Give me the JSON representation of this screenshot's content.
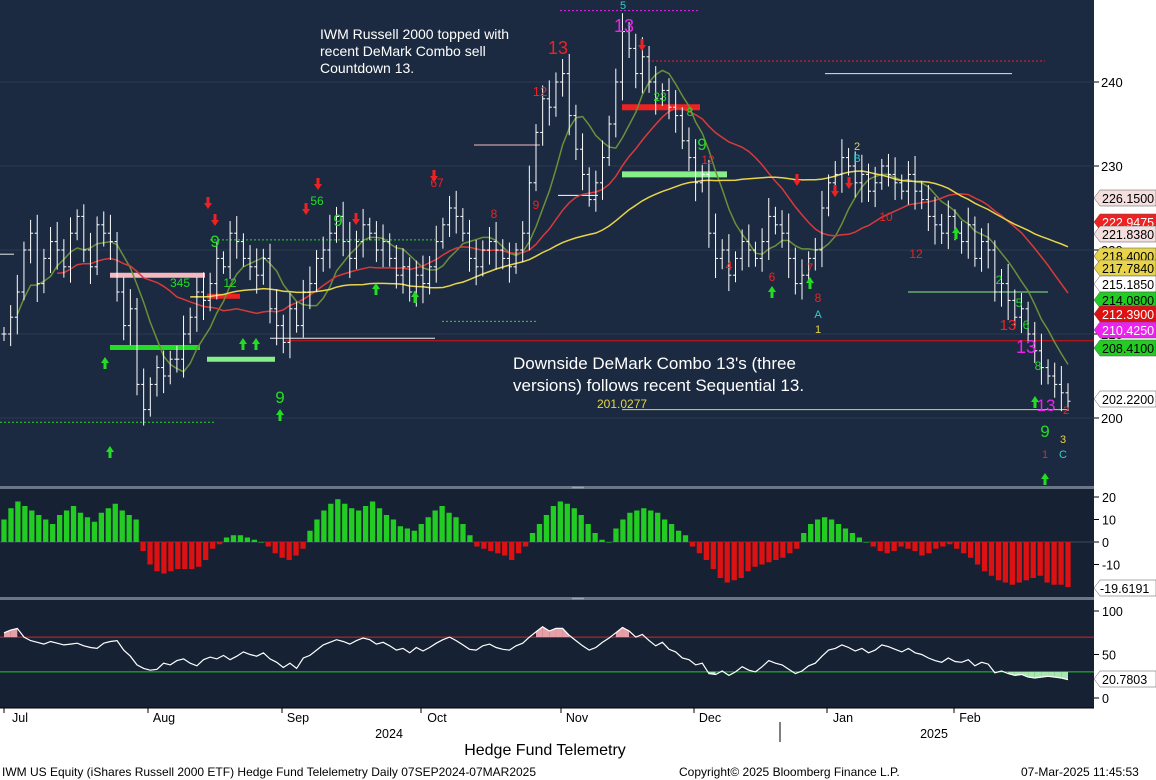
{
  "chart_title": "Hedge Fund Telemetry",
  "footer": {
    "left": "IWM US Equity (iShares Russell 2000 ETF) Hedge Fund Telelemetry  Daily 07SEP2024-07MAR2025",
    "center": "Copyright© 2025 Bloomberg Finance L.P.",
    "right": "07-Mar-2025 11:45:53"
  },
  "annotations": {
    "top_note": [
      "IWM Russell 2000 topped with",
      "recent DeMark Combo sell",
      "Countdown 13."
    ],
    "bottom_note": [
      "Downside DeMark Combo 13's (three",
      "versions) follows recent Sequential 13."
    ],
    "level_label": "201.0277"
  },
  "colors": {
    "background": "#162234",
    "price_bars": "#ffffff",
    "ma_short": "#6b8f3a",
    "ma_mid": "#d83a3a",
    "ma_long": "#e8d44a",
    "hist_pos": "#22cc22",
    "hist_neg": "#dd1111",
    "rsi_line": "#ffffff",
    "td_green": "#22dd22",
    "td_red": "#ee2222",
    "td_magenta": "#ee22ee"
  },
  "chart_data": [
    {
      "type": "candlestick",
      "panel": "price",
      "x_axis": {
        "months": [
          "Jul",
          "Aug",
          "Sep",
          "Oct",
          "Nov",
          "Dec",
          "Jan",
          "Feb"
        ],
        "years": [
          "2024",
          "2025"
        ]
      },
      "ylim": [
        190,
        250
      ],
      "yticks": [
        200,
        210,
        220,
        230,
        240
      ],
      "price_tags": [
        {
          "value": "226.1500",
          "color": "#f4dede",
          "text_color": "#000000"
        },
        {
          "value": "222.9475",
          "color": "#ee2222",
          "text_color": "#ffffff"
        },
        {
          "value": "221.8380",
          "color": "#f4dede",
          "text_color": "#000000"
        },
        {
          "value": "218.4000",
          "color": "#e8d44a",
          "text_color": "#000000"
        },
        {
          "value": "217.7840",
          "color": "#e8d44a",
          "text_color": "#000000"
        },
        {
          "value": "215.1850",
          "color": "#ffffff",
          "text_color": "#000000"
        },
        {
          "value": "214.0800",
          "color": "#22cc22",
          "text_color": "#000000"
        },
        {
          "value": "212.3900",
          "color": "#dd1111",
          "text_color": "#ffffff"
        },
        {
          "value": "210.4250",
          "color": "#ee22ee",
          "text_color": "#ffffff"
        },
        {
          "value": "208.4100",
          "color": "#22cc22",
          "text_color": "#000000"
        },
        {
          "value": "202.2200",
          "color": "#ffffff",
          "text_color": "#000000"
        }
      ],
      "close_series": [
        210,
        212,
        215,
        220,
        222,
        216,
        219,
        221,
        220,
        218,
        222,
        224,
        220,
        218,
        223,
        222,
        221,
        215,
        211,
        213,
        204,
        201,
        204,
        206,
        205,
        207,
        207,
        210,
        212,
        215,
        214,
        216,
        219,
        218,
        222,
        221,
        219,
        218,
        217,
        219,
        213,
        211,
        209,
        213,
        211,
        215,
        216,
        219,
        220,
        222,
        224,
        221,
        219,
        221,
        223,
        222,
        220,
        221,
        219,
        217,
        218,
        215,
        217,
        216,
        218,
        221,
        223,
        225,
        224,
        222,
        219,
        218,
        220,
        221,
        220,
        219,
        218,
        220,
        222,
        228,
        234,
        238,
        237,
        240,
        241,
        236,
        232,
        229,
        226,
        228,
        231,
        235,
        240,
        246,
        244,
        241,
        243,
        240,
        238,
        239,
        237,
        236,
        233,
        231,
        228,
        229,
        222,
        219,
        220,
        217,
        219,
        221,
        220,
        219,
        221,
        224,
        223,
        222,
        219,
        216,
        217,
        219,
        220,
        225,
        228,
        229,
        231,
        230,
        228,
        229,
        227,
        228,
        230,
        229,
        228,
        227,
        229,
        227,
        226,
        224,
        223,
        222,
        224,
        222,
        221,
        223,
        219,
        221,
        220,
        215,
        216,
        214,
        212,
        213,
        210,
        208,
        206,
        205,
        204,
        203,
        202
      ]
    },
    {
      "type": "bar",
      "panel": "momentum_histogram",
      "ylim": [
        -25,
        22
      ],
      "yticks": [
        20,
        10,
        0,
        -10
      ],
      "last_value": "-19.6191",
      "values": [
        10,
        15,
        18,
        16,
        14,
        12,
        10,
        8,
        12,
        14,
        16,
        13,
        11,
        9,
        13,
        15,
        17,
        14,
        12,
        10,
        -4,
        -10,
        -13,
        -14,
        -13,
        -12,
        -12,
        -12,
        -11,
        -8,
        -3,
        -1,
        2,
        3,
        3,
        2,
        1,
        0,
        -2,
        -5,
        -7,
        -8,
        -6,
        -3,
        5,
        10,
        14,
        17,
        19,
        17,
        15,
        14,
        16,
        18,
        15,
        12,
        10,
        7,
        6,
        5,
        8,
        11,
        14,
        16,
        13,
        11,
        8,
        3,
        -2,
        -3,
        -4,
        -5,
        -6,
        -8,
        -5,
        -2,
        4,
        8,
        12,
        16,
        18,
        17,
        15,
        12,
        8,
        4,
        1,
        0,
        6,
        10,
        13,
        14,
        15,
        14,
        13,
        10,
        8,
        5,
        3,
        -2,
        -5,
        -8,
        -12,
        -16,
        -18,
        -17,
        -16,
        -13,
        -11,
        -10,
        -9,
        -8,
        -7,
        -5,
        -3,
        4,
        8,
        10,
        11,
        10,
        8,
        6,
        4,
        2,
        0,
        -2,
        -4,
        -5,
        -4,
        -2,
        -3,
        -4,
        -6,
        -5,
        -3,
        -2,
        -1,
        -3,
        -5,
        -7,
        -10,
        -13,
        -15,
        -17,
        -18,
        -19,
        -18,
        -17,
        -16,
        -15,
        -18,
        -19,
        -19,
        -20
      ]
    },
    {
      "type": "line",
      "panel": "rsi",
      "ylim": [
        -5,
        110
      ],
      "yticks": [
        100,
        50,
        0
      ],
      "reference_lines": [
        {
          "value": 70,
          "color": "#dd2222"
        },
        {
          "value": 30,
          "color": "#22cc22"
        }
      ],
      "last_value": "20.7803",
      "values": [
        75,
        78,
        80,
        70,
        66,
        64,
        62,
        65,
        63,
        61,
        62,
        63,
        60,
        58,
        57,
        63,
        65,
        66,
        55,
        48,
        38,
        34,
        32,
        33,
        40,
        38,
        43,
        45,
        40,
        37,
        44,
        47,
        45,
        49,
        44,
        48,
        53,
        50,
        48,
        52,
        45,
        41,
        35,
        40,
        34,
        46,
        49,
        55,
        61,
        64,
        67,
        65,
        62,
        66,
        69,
        67,
        62,
        64,
        60,
        55,
        57,
        52,
        58,
        54,
        58,
        63,
        67,
        70,
        66,
        61,
        56,
        55,
        60,
        62,
        58,
        56,
        55,
        60,
        63,
        70,
        76,
        82,
        77,
        80,
        80,
        72,
        66,
        60,
        55,
        58,
        64,
        69,
        75,
        81,
        77,
        70,
        73,
        66,
        60,
        64,
        56,
        53,
        46,
        44,
        38,
        40,
        28,
        27,
        31,
        26,
        30,
        36,
        32,
        30,
        36,
        43,
        40,
        38,
        33,
        28,
        31,
        37,
        40,
        48,
        55,
        57,
        61,
        58,
        54,
        57,
        52,
        55,
        61,
        59,
        56,
        53,
        57,
        52,
        50,
        46,
        43,
        41,
        46,
        42,
        41,
        44,
        37,
        41,
        39,
        29,
        31,
        28,
        26,
        27,
        24,
        23,
        24,
        25,
        24,
        23,
        21
      ]
    }
  ]
}
